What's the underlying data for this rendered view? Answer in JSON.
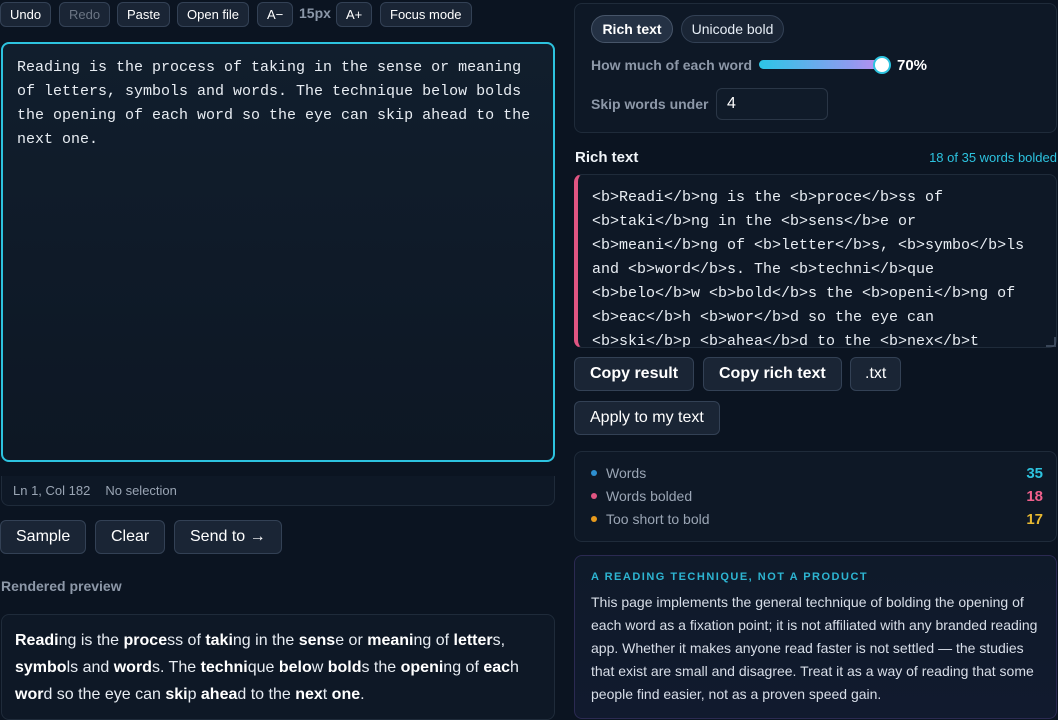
{
  "toolbar": {
    "undo": "Undo",
    "redo": "Redo",
    "paste": "Paste",
    "open_file": "Open file",
    "font_decrease": "A−",
    "font_size": "15px",
    "font_increase": "A+",
    "focus_mode": "Focus mode"
  },
  "editor": {
    "text": "Reading is the process of taking in the sense or meaning of letters, symbols and words. The technique below bolds the opening of each word so the eye can skip ahead to the next one."
  },
  "status": {
    "position": "Ln 1, Col 182",
    "selection": "No selection"
  },
  "actions": {
    "sample": "Sample",
    "clear": "Clear",
    "send_to": "Send to →"
  },
  "preview": {
    "heading": "Rendered preview",
    "segments": [
      {
        "b": "Readi",
        "t": "ng is the "
      },
      {
        "b": "proce",
        "t": "ss of "
      },
      {
        "b": "taki",
        "t": "ng in the "
      },
      {
        "b": "sens",
        "t": "e or "
      },
      {
        "b": "meani",
        "t": "ng of "
      },
      {
        "b": "letter",
        "t": "s, "
      },
      {
        "b": "symbo",
        "t": "ls and "
      },
      {
        "b": "word",
        "t": "s. The "
      },
      {
        "b": "techni",
        "t": "que "
      },
      {
        "b": "belo",
        "t": "w "
      },
      {
        "b": "bold",
        "t": "s the "
      },
      {
        "b": "openi",
        "t": "ng of "
      },
      {
        "b": "eac",
        "t": "h "
      },
      {
        "b": "wor",
        "t": "d so the eye can "
      },
      {
        "b": "ski",
        "t": "p "
      },
      {
        "b": "ahea",
        "t": "d to the "
      },
      {
        "b": "nex",
        "t": "t "
      },
      {
        "b": "one",
        "t": "."
      }
    ]
  },
  "options": {
    "mode_rich": "Rich text",
    "mode_unicode": "Unicode bold",
    "amount_label": "How much of each word",
    "amount_value": "70%",
    "amount_fraction": 0.7,
    "skip_label": "Skip words under",
    "skip_value": "4"
  },
  "rich": {
    "heading": "Rich text",
    "count": "18 of 35 words bolded",
    "output": "<b>Readi</b>ng is the <b>proce</b>ss of <b>taki</b>ng in the <b>sens</b>e or <b>meani</b>ng of <b>letter</b>s, <b>symbo</b>ls and <b>word</b>s. The <b>techni</b>que <b>belo</b>w <b>bold</b>s the <b>openi</b>ng of <b>eac</b>h <b>wor</b>d so the eye can <b>ski</b>p <b>ahea</b>d to the <b>nex</b>t <b>one</b>."
  },
  "output_actions": {
    "copy_result": "Copy result",
    "copy_rich": "Copy rich text",
    "txt": ".txt",
    "apply": "Apply to my text"
  },
  "stats": {
    "words_label": "Words",
    "words_value": "35",
    "bolded_label": "Words bolded",
    "bolded_value": "18",
    "short_label": "Too short to bold",
    "short_value": "17"
  },
  "colors": {
    "accent_cyan": "#2dc3df",
    "accent_pink": "#e05582",
    "accent_amber": "#e8b931"
  },
  "note": {
    "title": "A READING TECHNIQUE, NOT A PRODUCT",
    "body": "This page implements the general technique of bolding the opening of each word as a fixation point; it is not affiliated with any branded reading app. Whether it makes anyone read faster is not settled — the studies that exist are small and disagree. Treat it as a way of reading that some people find easier, not as a proven speed gain."
  }
}
